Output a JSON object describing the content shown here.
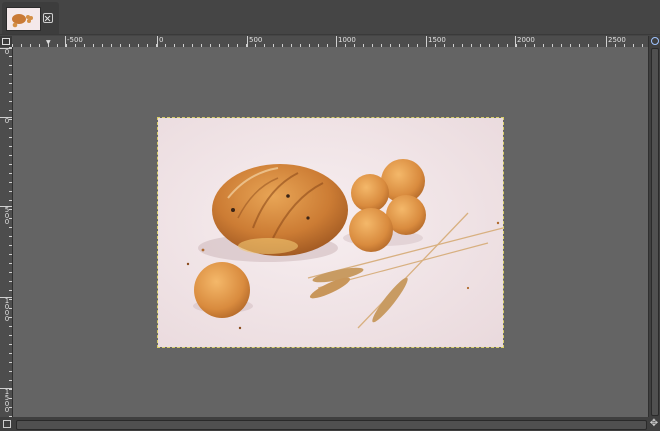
{
  "tab": {
    "thumbnail": "image-thumbnail",
    "close_icon": "close-icon"
  },
  "ruler_h": {
    "labels": [
      "-500",
      "0",
      "500",
      "1000",
      "1500",
      "2000",
      "2500"
    ]
  },
  "ruler_v": {
    "labels": [
      "0",
      "0",
      "500",
      "1000",
      "1500"
    ]
  },
  "icons": {
    "quick_mask": "quick-mask-icon",
    "navigate": "navigate-icon",
    "zoom_menu": "chevron-down-icon"
  },
  "image": {
    "subject": "bread-loaf-cookies-wheat-photo",
    "background": "#f3e6e8"
  }
}
